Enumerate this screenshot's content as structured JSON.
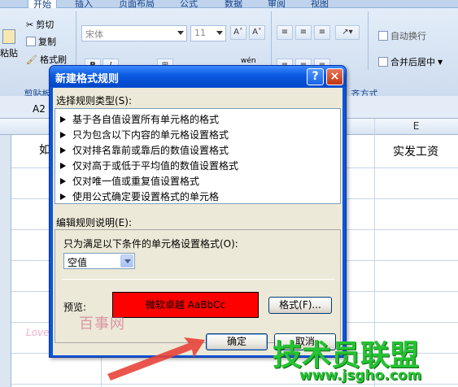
{
  "ribbon": {
    "tabs": [
      "开始",
      "插入",
      "页面布局",
      "公式",
      "数据",
      "审阅",
      "视图"
    ],
    "paste_label": "粘贴",
    "cut_label": "剪切",
    "copy_label": "复制",
    "format_painter_label": "格式刷",
    "clipboard_group": "剪贴板",
    "font_name": "宋体",
    "font_size": "11",
    "align_group": "齐方式",
    "wrap_text_label": "自动换行",
    "merge_center_label": "合并后居中",
    "wen_label": "wén"
  },
  "sheet": {
    "name_box": "A2",
    "col_e_letter": "E",
    "col_a_partial": "如",
    "col_e_header": "实发工资"
  },
  "dialog": {
    "title": "新建格式规则",
    "help_label": "?",
    "close_label": "×",
    "rule_type_label": "选择规则类型(S):",
    "rule_types": [
      "基于各自值设置所有单元格的格式",
      "只为包含以下内容的单元格设置格式",
      "仅对排名靠前或靠后的数值设置格式",
      "仅对高于或低于平均值的数值设置格式",
      "仅对唯一值或重复值设置格式",
      "使用公式确定要设置格式的单元格"
    ],
    "edit_desc_label": "编辑规则说明(E):",
    "condition_label": "只为满足以下条件的单元格设置格式(O):",
    "condition_value": "空值",
    "preview_label": "预览:",
    "preview_text": "微软卓越  AaBbCc",
    "format_button": "格式(F)...",
    "ok_button": "确定",
    "cancel_button": "取消"
  },
  "watermarks": {
    "baidu": "百事网",
    "site_cn": "技术员联盟",
    "site_url": "www.jsgho.com",
    "love": "Love"
  },
  "colors": {
    "preview_fill": "#ff0000",
    "title_bar": "#0a5ae0",
    "watermark_green": "#26c332"
  }
}
